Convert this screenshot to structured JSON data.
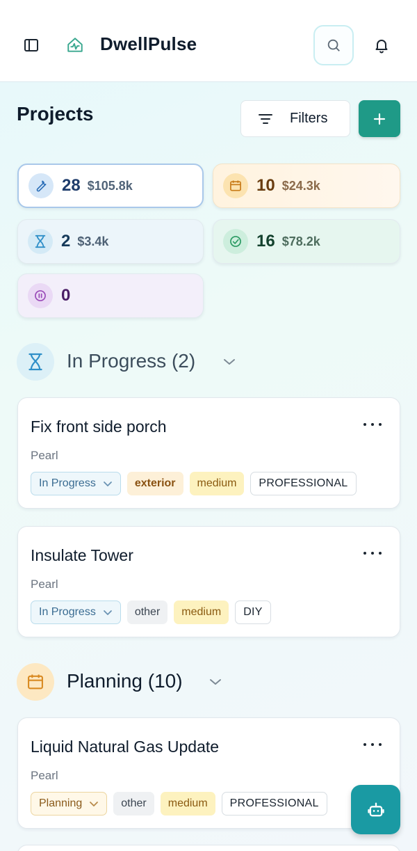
{
  "header": {
    "app_title": "DwellPulse"
  },
  "page": {
    "title": "Projects",
    "filters_label": "Filters"
  },
  "stats": {
    "active": {
      "count": "28",
      "amount": "$105.8k"
    },
    "planning": {
      "count": "10",
      "amount": "$24.3k"
    },
    "in_progress": {
      "count": "2",
      "amount": "$3.4k"
    },
    "completed": {
      "count": "16",
      "amount": "$78.2k"
    },
    "on_hold": {
      "count": "0"
    }
  },
  "sections": {
    "in_progress": {
      "title": "In Progress (2)"
    },
    "planning": {
      "title": "Planning (10)"
    }
  },
  "projects": [
    {
      "name": "Fix front side porch",
      "owner": "Pearl",
      "status": "In Progress",
      "category": "exterior",
      "priority": "medium",
      "who": "PROFESSIONAL"
    },
    {
      "name": "Insulate Tower",
      "owner": "Pearl",
      "status": "In Progress",
      "category": "other",
      "priority": "medium",
      "who": "DIY"
    },
    {
      "name": "Liquid Natural Gas Update",
      "owner": "Pearl",
      "status": "Planning",
      "category": "other",
      "priority": "medium",
      "who": "PROFESSIONAL"
    }
  ],
  "colors": {
    "accent": "#1f9a87",
    "fab": "#1a9aa3",
    "in_progress_blue": "#2f8fc8",
    "planning_orange": "#d98a22"
  }
}
